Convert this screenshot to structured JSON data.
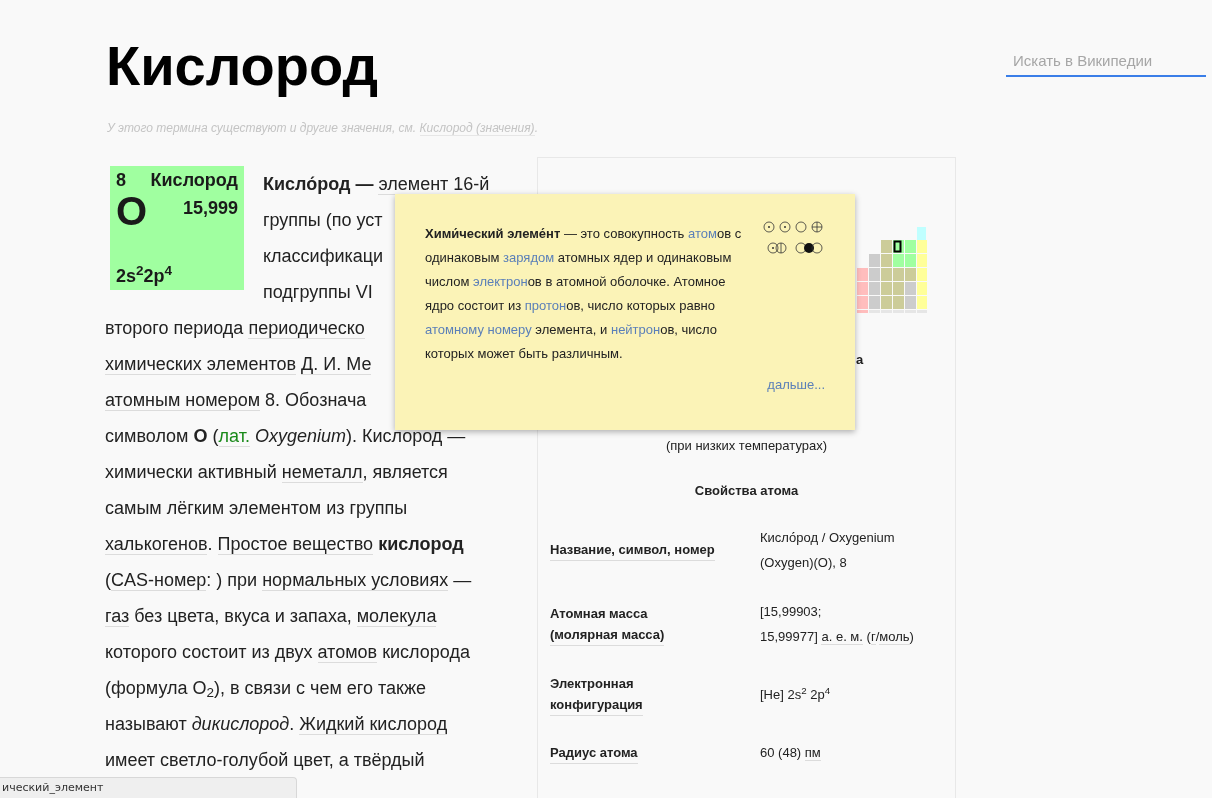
{
  "header": {
    "title": "Кислород",
    "search": {
      "placeholder": "Искать в Википедии"
    }
  },
  "hatnote": [
    {
      "kind": "text",
      "text": "У этого термина существуют и другие значения, см. "
    },
    {
      "kind": "link",
      "text": "Кислород (значения)"
    },
    {
      "kind": "text",
      "text": "."
    }
  ],
  "element_tile": {
    "number": "8",
    "name": "Кислород",
    "symbol": "O",
    "mass": "15,999",
    "config": "2s$^{2}$2p$^{4}$"
  },
  "article": {
    "lines": [
      [
        {
          "kind": "text",
          "text": "**Кисло́род —** "
        },
        {
          "kind": "link",
          "text": "элемент"
        },
        {
          "kind": "text",
          "text": " 16-й"
        }
      ],
      [
        {
          "kind": "text",
          "text": "группы (по уст"
        }
      ],
      [
        {
          "kind": "text",
          "text": "классификаци"
        }
      ],
      [
        {
          "kind": "text",
          "text": "подгруппы VI"
        }
      ],
      [
        {
          "kind": "text",
          "text": "второго периода "
        },
        {
          "kind": "link",
          "text": "периодическо"
        }
      ],
      [
        {
          "kind": "link",
          "text": "химических элементов"
        },
        {
          "kind": "link",
          "text": "Д. И. Ме"
        }
      ],
      [
        {
          "kind": "link",
          "text": "атомным номером"
        },
        {
          "kind": "text",
          "text": " 8. Обознача"
        }
      ],
      [
        {
          "kind": "text",
          "text": "символом **O** ("
        },
        {
          "kind": "abbr",
          "text": "лат."
        },
        {
          "kind": "text",
          "text": " *Oxygenium*). Кислород —"
        }
      ],
      [
        {
          "kind": "text",
          "text": "химически активный "
        },
        {
          "kind": "link",
          "text": "неметалл"
        },
        {
          "kind": "text",
          "text": ", является"
        }
      ],
      [
        {
          "kind": "text",
          "text": "самым лёгким элементом из группы"
        }
      ],
      [
        {
          "kind": "link",
          "text": "халькогенов"
        },
        {
          "kind": "text",
          "text": ". "
        },
        {
          "kind": "link",
          "text": "Простое вещество"
        },
        {
          "kind": "text",
          "text": " **кислород**"
        }
      ],
      [
        {
          "kind": "text",
          "text": "("
        },
        {
          "kind": "link",
          "text": "CAS-номер"
        },
        {
          "kind": "text",
          "text": ": ) при "
        },
        {
          "kind": "link",
          "text": "нормальных условиях"
        },
        {
          "kind": "text",
          "text": " —"
        }
      ],
      [
        {
          "kind": "link",
          "text": "газ"
        },
        {
          "kind": "text",
          "text": " без цвета, вкуса и запаха, "
        },
        {
          "kind": "link",
          "text": "молекула"
        }
      ],
      [
        {
          "kind": "text",
          "text": "которого состоит из двух "
        },
        {
          "kind": "link",
          "text": "атомов"
        },
        {
          "kind": "text",
          "text": " кислорода"
        }
      ],
      [
        {
          "kind": "text",
          "text": "(формула O$_{2}$), в связи с чем его также"
        }
      ],
      [
        {
          "kind": "text",
          "text": "называют *дикислород*. "
        },
        {
          "kind": "link",
          "text": "Жидкий кислород"
        }
      ],
      [
        {
          "kind": "text",
          "text": "имеет светло-голубой цвет, а твёрдый"
        }
      ]
    ]
  },
  "infobox": {
    "heading_fragment": "а",
    "caption": "(при низких температурах)",
    "section": "Свойства атома",
    "rows": [
      {
        "label": [
          "Название, символ, номер"
        ],
        "value": [
          [
            {
              "kind": "text",
              "text": "Кисло́род / Oxygenium"
            }
          ],
          [
            {
              "kind": "text",
              "text": "(Oxygen)(O), 8"
            }
          ]
        ]
      },
      {
        "label": [
          "Атомная масса",
          "(молярная масса)"
        ],
        "value": [
          [
            {
              "kind": "text",
              "text": "[15,99903;"
            }
          ],
          [
            {
              "kind": "text",
              "text": "15,99977] "
            },
            {
              "kind": "link",
              "text": "а. е. м."
            },
            {
              "kind": "text",
              "text": " ("
            },
            {
              "kind": "link",
              "text": "г"
            },
            {
              "kind": "text",
              "text": "/"
            },
            {
              "kind": "link",
              "text": "моль"
            },
            {
              "kind": "text",
              "text": ")"
            }
          ]
        ]
      },
      {
        "label": [
          "Электронная",
          "конфигурация"
        ],
        "value": [
          [
            {
              "kind": "text",
              "text": "[He] 2s$^{2}$ 2p$^{4}$"
            }
          ]
        ]
      },
      {
        "label": [
          "Радиус атома"
        ],
        "value": [
          [
            {
              "kind": "text",
              "text": "60 (48) "
            },
            {
              "kind": "link",
              "text": "пм"
            }
          ]
        ]
      }
    ]
  },
  "tooltip": {
    "text": [
      {
        "kind": "text",
        "text": "**Хими́ческий элеме́нт** — это совокупность "
      },
      {
        "kind": "link",
        "text": "атом"
      },
      {
        "kind": "text",
        "text": "ов с одинаковым "
      },
      {
        "kind": "link",
        "text": "зарядом"
      },
      {
        "kind": "text",
        "text": " атомных ядер и одинаковым числом "
      },
      {
        "kind": "link",
        "text": "электрон"
      },
      {
        "kind": "text",
        "text": "ов в атомной оболочке. Атомное ядро состоит из "
      },
      {
        "kind": "link",
        "text": "протон"
      },
      {
        "kind": "text",
        "text": "ов, число которых равно "
      },
      {
        "kind": "link",
        "text": "атомному номеру"
      },
      {
        "kind": "text",
        "text": " элемента, и "
      },
      {
        "kind": "link",
        "text": "нейтрон"
      },
      {
        "kind": "text",
        "text": "ов, число которых может быть различным."
      }
    ],
    "more": "дальше..."
  },
  "status_bar": {
    "text": "ический_элемент"
  }
}
